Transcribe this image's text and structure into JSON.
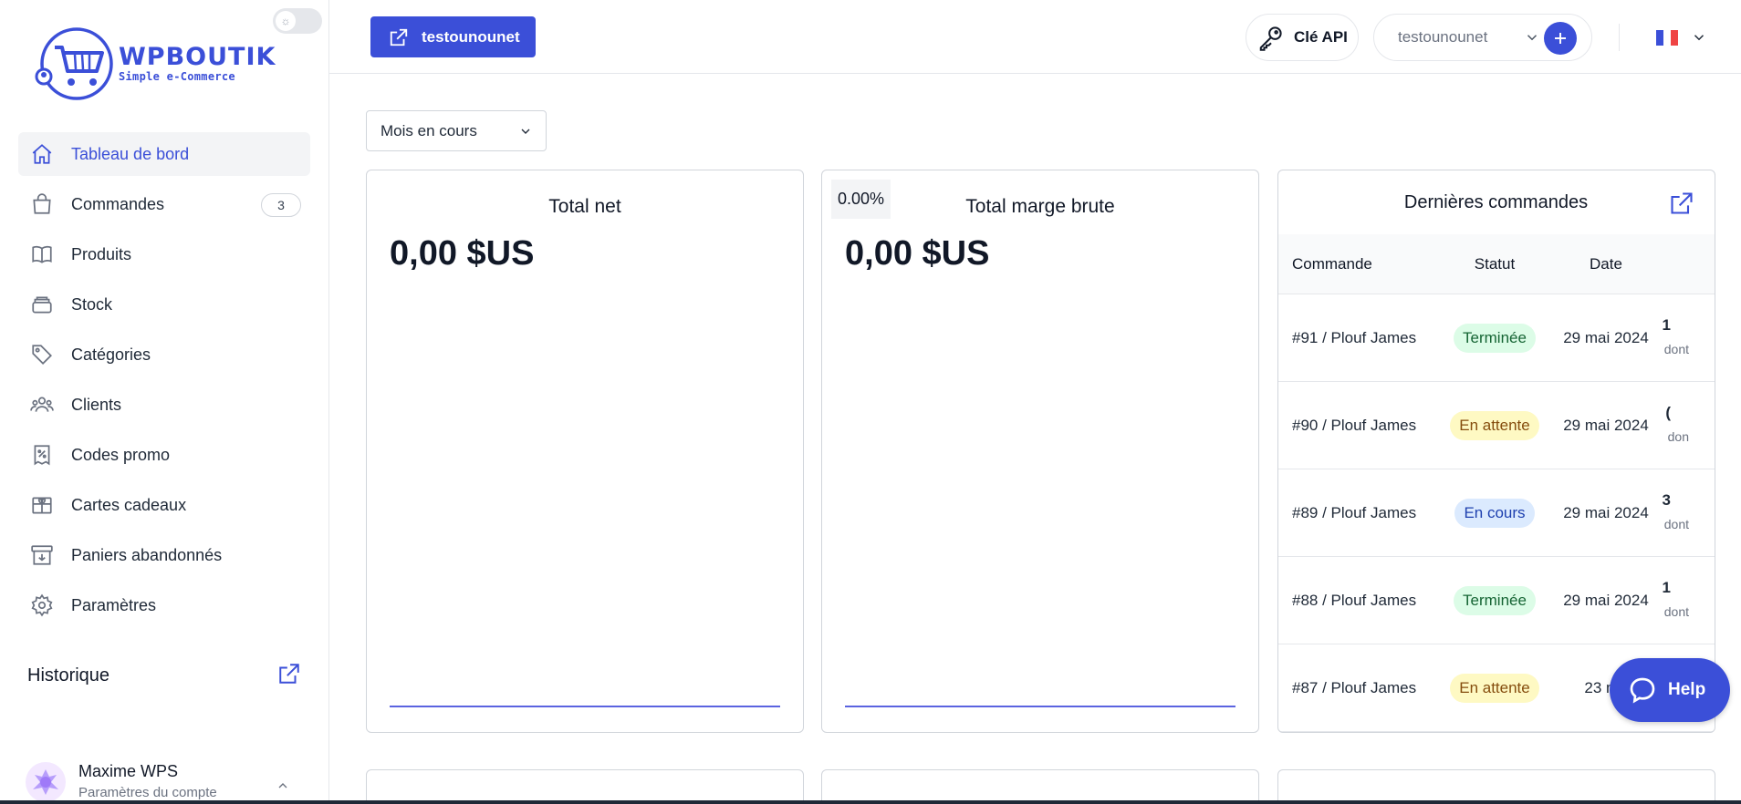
{
  "sidebar": {
    "logo": {
      "title": "WPBOUTIK",
      "subtitle": "Simple e-Commerce"
    },
    "items": [
      {
        "label": "Tableau de bord",
        "icon": "home-icon",
        "active": true
      },
      {
        "label": "Commandes",
        "icon": "shopping-bag-icon",
        "badge": "3"
      },
      {
        "label": "Produits",
        "icon": "book-icon"
      },
      {
        "label": "Stock",
        "icon": "archive-icon"
      },
      {
        "label": "Catégories",
        "icon": "tag-icon"
      },
      {
        "label": "Clients",
        "icon": "users-icon"
      },
      {
        "label": "Codes promo",
        "icon": "receipt-percent-icon"
      },
      {
        "label": "Cartes cadeaux",
        "icon": "gift-icon"
      },
      {
        "label": "Paniers abandonnés",
        "icon": "archive-box-down-icon"
      },
      {
        "label": "Paramètres",
        "icon": "gear-icon"
      }
    ],
    "history_label": "Historique",
    "user": {
      "name": "Maxime WPS",
      "subtitle": "Paramètres du compte"
    }
  },
  "topbar": {
    "store_button": "testounounet",
    "api_button": "Clé API",
    "shop_select": "testounounet"
  },
  "filter": {
    "period": "Mois en cours"
  },
  "cards": {
    "total_net": {
      "title": "Total net",
      "value": "0,00 $US"
    },
    "total_marge": {
      "title": "Total marge brute",
      "value": "0,00 $US",
      "badge": "0.00%"
    }
  },
  "orders": {
    "title": "Dernières commandes",
    "columns": [
      "Commande",
      "Statut",
      "Date"
    ],
    "rows": [
      {
        "order": "#91 / Plouf James",
        "status": "Terminée",
        "status_type": "done",
        "date": "29 mai 2024",
        "amount": "1",
        "sub": "dont"
      },
      {
        "order": "#90 / Plouf James",
        "status": "En attente",
        "status_type": "wait",
        "date": "29 mai 2024",
        "amount": "(",
        "sub": "don"
      },
      {
        "order": "#89 / Plouf James",
        "status": "En cours",
        "status_type": "prog",
        "date": "29 mai 2024",
        "amount": "3",
        "sub": "dont"
      },
      {
        "order": "#88 / Plouf James",
        "status": "Terminée",
        "status_type": "done",
        "date": "29 mai 2024",
        "amount": "1",
        "sub": "dont"
      },
      {
        "order": "#87 / Plouf James",
        "status": "En attente",
        "status_type": "wait",
        "date": "23 ma",
        "amount": "",
        "sub": ""
      }
    ]
  },
  "help": {
    "label": "Help"
  },
  "colors": {
    "accent": "#3b4fd8",
    "chart_line": "#5b63e0"
  }
}
